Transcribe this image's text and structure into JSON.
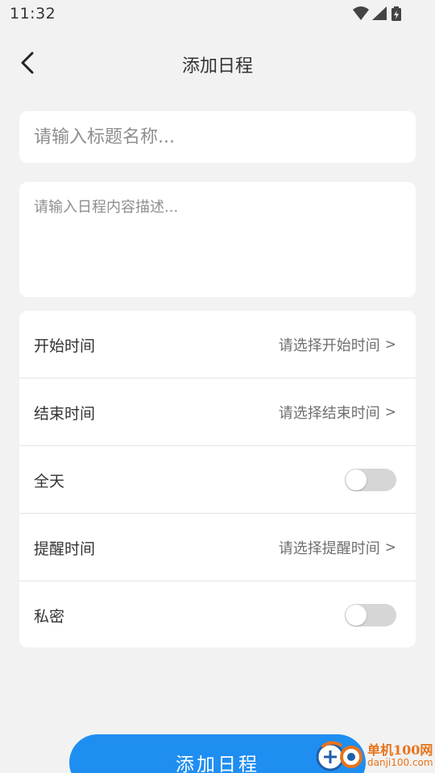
{
  "status_bar": {
    "time": "11:32",
    "icons": [
      "wifi-icon",
      "signal-icon",
      "battery-charging-icon"
    ]
  },
  "header": {
    "title": "添加日程",
    "back_icon": "chevron-left-icon"
  },
  "form": {
    "title_placeholder": "请输入标题名称...",
    "title_value": "",
    "description_placeholder": "请输入日程内容描述...",
    "description_value": ""
  },
  "settings": {
    "start_time": {
      "label": "开始时间",
      "value": "请选择开始时间",
      "chevron": ">"
    },
    "end_time": {
      "label": "结束时间",
      "value": "请选择结束时间",
      "chevron": ">"
    },
    "all_day": {
      "label": "全天",
      "on": false
    },
    "reminder_time": {
      "label": "提醒时间",
      "value": "请选择提醒时间",
      "chevron": ">"
    },
    "private": {
      "label": "私密",
      "on": false
    }
  },
  "submit_label": "添加日程",
  "watermark": {
    "name": "单机100网",
    "url": "danji100.com"
  },
  "colors": {
    "background": "#f2f2f2",
    "card": "#ffffff",
    "accent": "#1f8ef1",
    "toggle_off": "#d6d6d6",
    "watermark": "#e8731a"
  }
}
